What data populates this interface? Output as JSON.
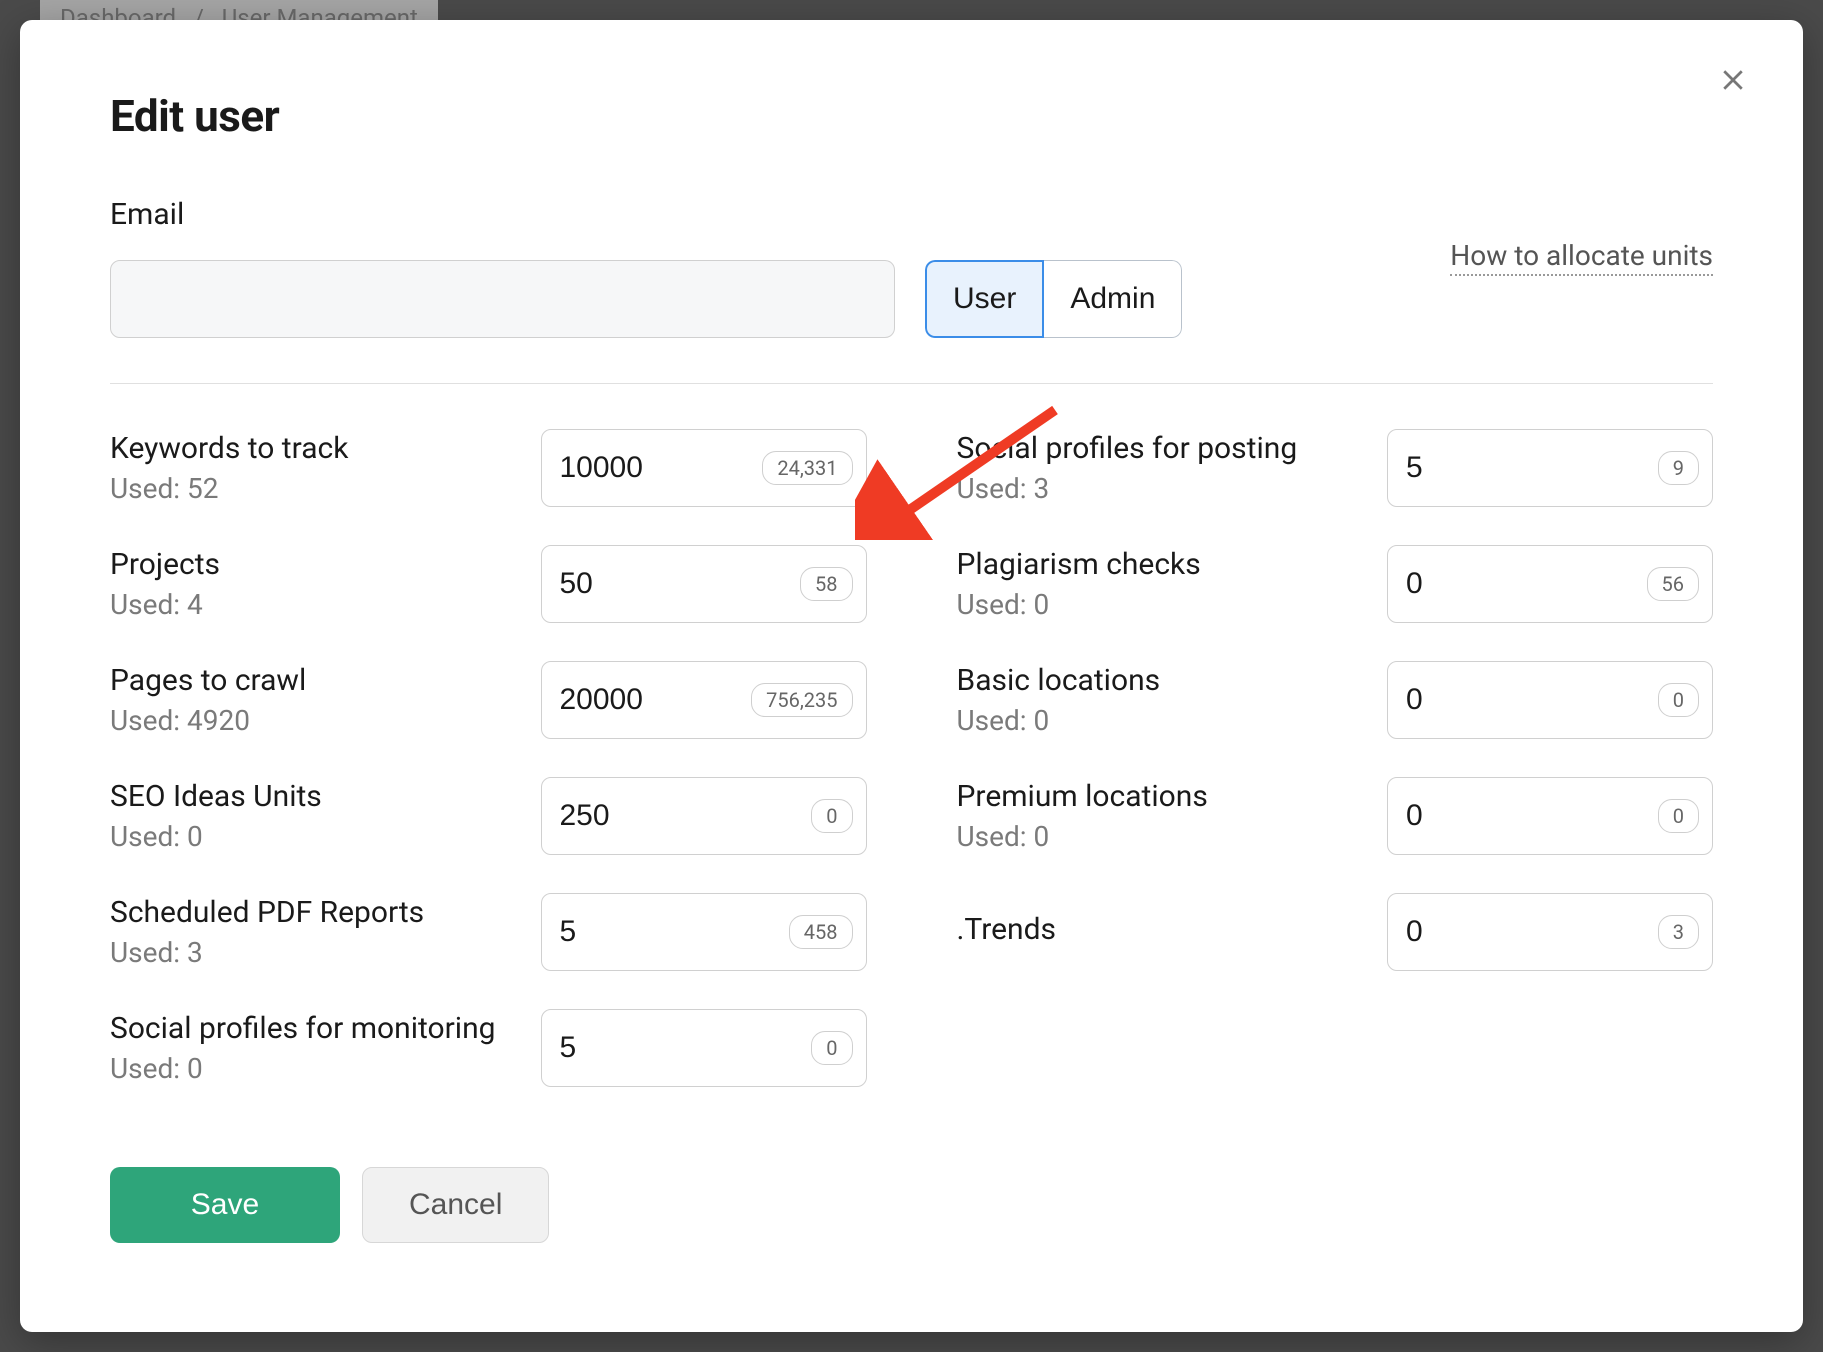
{
  "breadcrumb": {
    "item1": "Dashboard",
    "sep": "/",
    "item2": "User Management"
  },
  "modal": {
    "title": "Edit user",
    "email_label": "Email",
    "email_value": "",
    "role_user": "User",
    "role_admin": "Admin",
    "help_link": "How to allocate units",
    "save": "Save",
    "cancel": "Cancel"
  },
  "used_prefix": "Used: ",
  "limits_left": [
    {
      "label": "Keywords to track",
      "used": "52",
      "value": "10000",
      "badge": "24,331"
    },
    {
      "label": "Projects",
      "used": "4",
      "value": "50",
      "badge": "58"
    },
    {
      "label": "Pages to crawl",
      "used": "4920",
      "value": "20000",
      "badge": "756,235"
    },
    {
      "label": "SEO Ideas Units",
      "used": "0",
      "value": "250",
      "badge": "0"
    },
    {
      "label": "Scheduled PDF Reports",
      "used": "3",
      "value": "5",
      "badge": "458"
    },
    {
      "label": "Social profiles for monitoring",
      "used": "0",
      "value": "5",
      "badge": "0"
    }
  ],
  "limits_right": [
    {
      "label": "Social profiles for posting",
      "used": "3",
      "value": "5",
      "badge": "9"
    },
    {
      "label": "Plagiarism checks",
      "used": "0",
      "value": "0",
      "badge": "56"
    },
    {
      "label": "Basic locations",
      "used": "0",
      "value": "0",
      "badge": "0"
    },
    {
      "label": "Premium locations",
      "used": "0",
      "value": "0",
      "badge": "0"
    },
    {
      "label": ".Trends",
      "used": "",
      "value": "0",
      "badge": "3"
    }
  ]
}
